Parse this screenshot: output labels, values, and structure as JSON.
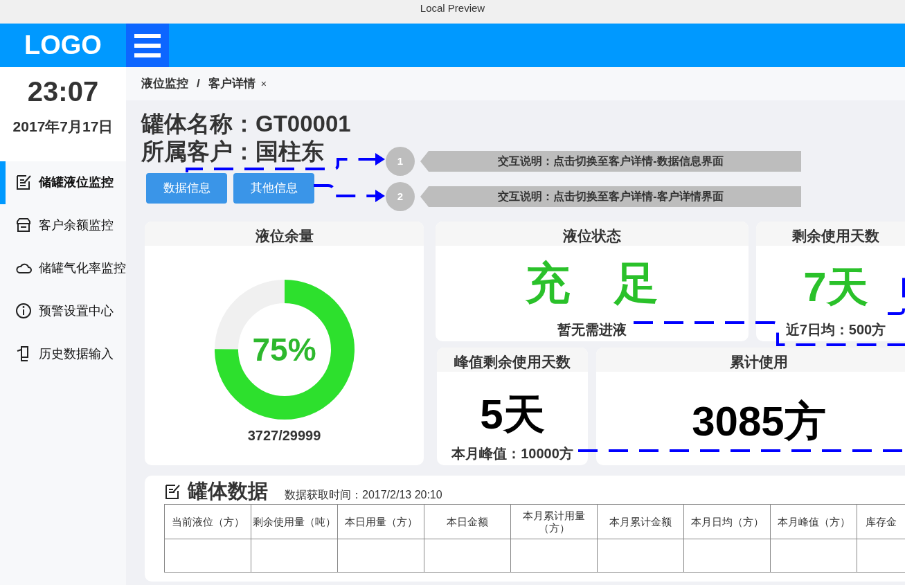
{
  "window": {
    "title": "Local Preview"
  },
  "header": {
    "logo": "LOGO"
  },
  "sidebar": {
    "time": "23:07",
    "date": "2017年7月17日",
    "items": [
      {
        "label": "储罐液位监控",
        "selected": true
      },
      {
        "label": "客户余额监控",
        "selected": false
      },
      {
        "label": "储罐气化率监控",
        "selected": false
      },
      {
        "label": "预警设置中心",
        "selected": false
      },
      {
        "label": "历史数据输入",
        "selected": false
      }
    ]
  },
  "breadcrumb": {
    "items": [
      "液位监控",
      "客户详情"
    ],
    "separator": "/",
    "close": "×"
  },
  "tank": {
    "lines": [
      "罐体名称：GT00001",
      "所属客户：国柱东"
    ]
  },
  "buttons": [
    "数据信息",
    "其他信息"
  ],
  "annotations": [
    {
      "number": "1",
      "text": "交互说明：点击切换至客户详情-数据信息界面"
    },
    {
      "number": "2",
      "text": "交互说明：点击切换至客户详情-客户详情界面"
    }
  ],
  "level_card": {
    "title": "液位余量",
    "level": 0.75,
    "percent": "75%",
    "reading": "3727/29999"
  },
  "stat_cards": [
    {
      "title": "液位状态",
      "value": "充　足",
      "note": "暂无需进液",
      "color": "#2ac12a"
    },
    {
      "title": "剩余使用天数",
      "value": "7天",
      "note": "近7日均：500方",
      "color": "#2ac12a"
    },
    {
      "title": "峰值剩余使用天数",
      "value": "5天",
      "note": "本月峰值：10000方",
      "color": "#000000"
    },
    {
      "title": "累计使用",
      "value": "3085方",
      "color": "#000000"
    }
  ],
  "table_section": {
    "title": "罐体数据",
    "fetch_time": "数据获取时间：2017/2/13 20:10",
    "columns": [
      "当前液位（方）",
      "剩余使用量（吨）",
      "本日用量（方）",
      "本日金额",
      "本月累计用量（方）",
      "本月累计金额",
      "本月日均（方）",
      "本月峰值（方）",
      "库存金"
    ]
  }
}
